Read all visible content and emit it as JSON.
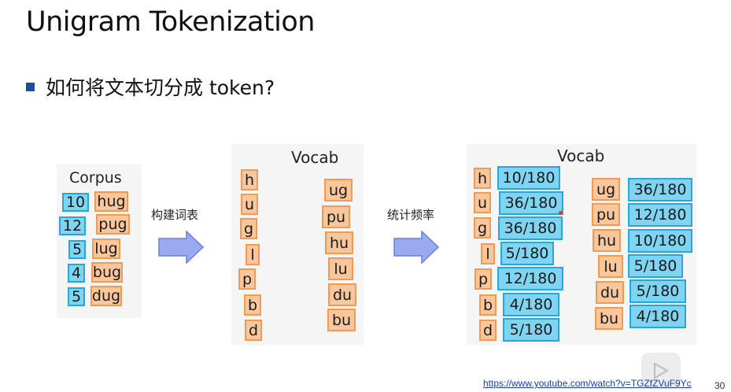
{
  "slide": {
    "title": "Unigram Tokenization",
    "bullet": "如何将文本切分成 token?",
    "page_number": "30",
    "url": "https://www.youtube.com/watch?v=TGZfZVuF9Yc"
  },
  "corpus": {
    "label": "Corpus",
    "counts": [
      "10",
      "12",
      "5",
      "4",
      "5"
    ],
    "words": [
      "hug",
      "pug",
      "lug",
      "bug",
      "dug"
    ]
  },
  "step1_label": "构建词表",
  "step2_label": "统计频率",
  "vocab1": {
    "label": "Vocab",
    "chars": [
      "h",
      "u",
      "g",
      "l",
      "p",
      "b",
      "d"
    ],
    "pairs": [
      "ug",
      "pu",
      "hu",
      "lu",
      "du",
      "bu"
    ]
  },
  "vocab2": {
    "label": "Vocab",
    "chars": [
      "h",
      "u",
      "g",
      "l",
      "p",
      "b",
      "d"
    ],
    "char_freqs": [
      "10/180",
      "36/180",
      "36/180",
      "5/180",
      "12/180",
      "4/180",
      "5/180"
    ],
    "pairs": [
      "ug",
      "pu",
      "hu",
      "lu",
      "du",
      "bu"
    ],
    "pair_freqs": [
      "36/180",
      "12/180",
      "10/180",
      "5/180",
      "5/180",
      "4/180"
    ]
  },
  "colors": {
    "blue_fill": "#7fd4f2",
    "blue_border": "#25a7d8",
    "orange_fill": "#f9c79b",
    "orange_border": "#ef9a55",
    "arrow": "#9aaaf0"
  }
}
